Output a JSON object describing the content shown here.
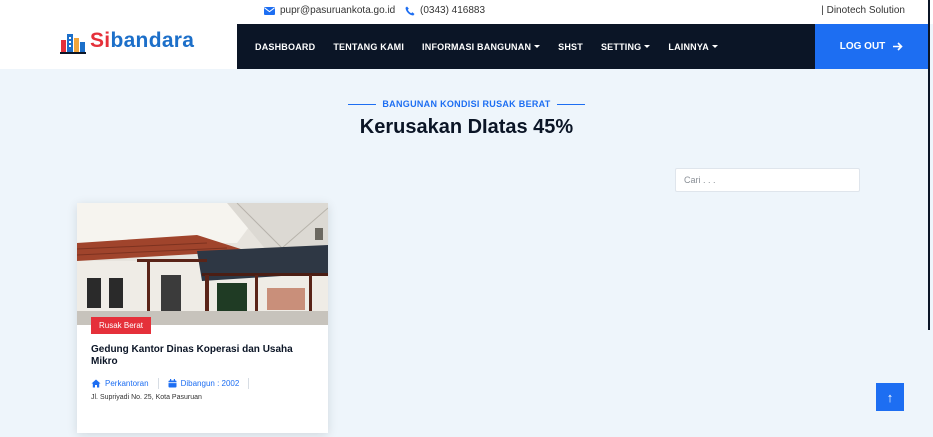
{
  "topbar": {
    "email": "pupr@pasuruankota.go.id",
    "phone": "(0343) 416883",
    "company": "| Dinotech Solution"
  },
  "brand": {
    "name_prefix": "Si",
    "name_suffix": "bandara",
    "accent": "#1c6fc9",
    "accent_red": "#e5303a"
  },
  "nav": {
    "items": [
      {
        "label": "DASHBOARD",
        "dropdown": false
      },
      {
        "label": "TENTANG KAMI",
        "dropdown": false
      },
      {
        "label": "INFORMASI BANGUNAN",
        "dropdown": true
      },
      {
        "label": "SHST",
        "dropdown": false
      },
      {
        "label": "SETTING",
        "dropdown": true
      },
      {
        "label": "LAINNYA",
        "dropdown": true
      }
    ],
    "logout_label": "LOG OUT"
  },
  "section": {
    "subtitle": "BANGUNAN KONDISI RUSAK BERAT",
    "title": "Kerusakan DIatas 45%"
  },
  "search": {
    "placeholder": "Cari . . ."
  },
  "cards": [
    {
      "badge": "Rusak Berat",
      "title": "Gedung Kantor Dinas Koperasi dan Usaha Mikro",
      "category": "Perkantoran",
      "built": "Dibangun : 2002",
      "address": "Jl. Supriyadi No. 25, Kota Pasuruan"
    }
  ],
  "colors": {
    "primary": "#1d6ef2",
    "navbar": "#0b1526",
    "background": "#eef5fb",
    "danger": "#e5303a"
  }
}
